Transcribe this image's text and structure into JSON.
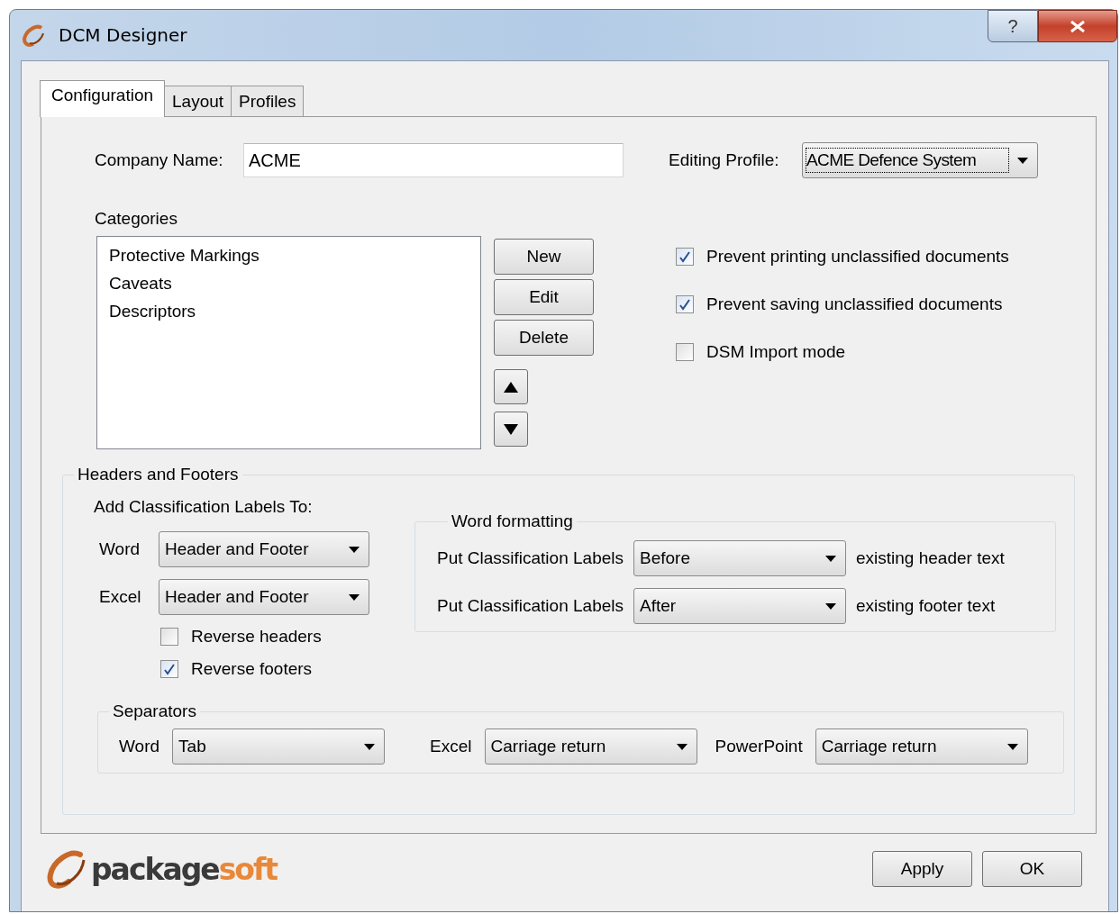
{
  "window": {
    "title": "DCM Designer",
    "help_button": "?"
  },
  "tabs": [
    {
      "label": "Configuration",
      "selected": true
    },
    {
      "label": "Layout",
      "selected": false
    },
    {
      "label": "Profiles",
      "selected": false
    }
  ],
  "company_name": {
    "label": "Company Name:",
    "value": "ACME"
  },
  "editing_profile": {
    "label": "Editing Profile:",
    "value": "ACME Defence System"
  },
  "categories": {
    "label": "Categories",
    "items": [
      {
        "label": "Protective Markings",
        "selected": false
      },
      {
        "label": "Caveats",
        "selected": false
      },
      {
        "label": "Descriptors",
        "selected": false
      }
    ],
    "buttons": [
      "New",
      "Edit",
      "Delete"
    ]
  },
  "options": [
    {
      "label": "Prevent printing unclassified documents",
      "checked": true
    },
    {
      "label": "Prevent saving unclassified documents",
      "checked": true
    },
    {
      "label": "DSM Import mode",
      "checked": false
    }
  ],
  "headers_footers": {
    "title": "Headers and Footers",
    "add_labels_title": "Add Classification Labels To:",
    "targets": [
      {
        "label": "Word",
        "value": "Header and Footer"
      },
      {
        "label": "Excel",
        "value": "Header and Footer"
      }
    ],
    "reverse": [
      {
        "label": "Reverse headers",
        "checked": false
      },
      {
        "label": "Reverse footers",
        "checked": true
      }
    ],
    "word_formatting": {
      "title": "Word formatting",
      "rows": [
        {
          "label": "Put Classification Labels",
          "value": "Before",
          "suffix": "existing header text"
        },
        {
          "label": "Put Classification Labels",
          "value": "After",
          "suffix": "existing footer text"
        }
      ]
    },
    "separators": {
      "title": "Separators",
      "items": [
        {
          "label": "Word",
          "value": "Tab"
        },
        {
          "label": "Excel",
          "value": "Carriage return"
        },
        {
          "label": "PowerPoint",
          "value": "Carriage return"
        }
      ]
    }
  },
  "logo": {
    "dark": "package",
    "accent": "soft"
  },
  "buttons": [
    "Apply",
    "OK"
  ]
}
